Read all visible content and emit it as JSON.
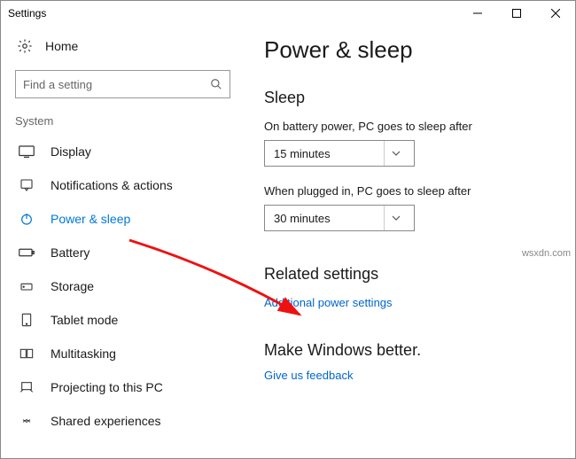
{
  "window": {
    "title": "Settings"
  },
  "sidebar": {
    "home_label": "Home",
    "search_placeholder": "Find a setting",
    "section_label": "System",
    "items": [
      {
        "label": "Display"
      },
      {
        "label": "Notifications & actions"
      },
      {
        "label": "Power & sleep"
      },
      {
        "label": "Battery"
      },
      {
        "label": "Storage"
      },
      {
        "label": "Tablet mode"
      },
      {
        "label": "Multitasking"
      },
      {
        "label": "Projecting to this PC"
      },
      {
        "label": "Shared experiences"
      }
    ]
  },
  "main": {
    "title": "Power & sleep",
    "sleep": {
      "heading": "Sleep",
      "battery_label": "On battery power, PC goes to sleep after",
      "battery_value": "15 minutes",
      "plugged_label": "When plugged in, PC goes to sleep after",
      "plugged_value": "30 minutes"
    },
    "related": {
      "heading": "Related settings",
      "link": "Additional power settings"
    },
    "feedback": {
      "heading": "Make Windows better.",
      "link": "Give us feedback"
    }
  },
  "watermark": "wsxdn.com"
}
